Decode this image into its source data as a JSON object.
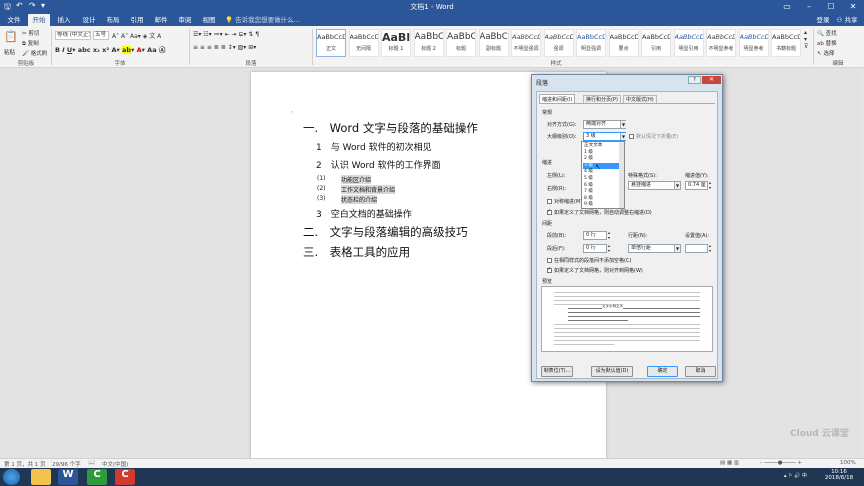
{
  "window": {
    "title": "文档1 - Word"
  },
  "tabs": [
    "文件",
    "开始",
    "插入",
    "设计",
    "布局",
    "引用",
    "邮件",
    "审阅",
    "视图"
  ],
  "search": {
    "placeholder": "告诉我您想要做什么..."
  },
  "account": {
    "login": "登录",
    "share": "共享"
  },
  "ribbon": {
    "clipboard": {
      "paste": "粘贴",
      "cut": "剪切",
      "copy": "复制",
      "format_painter": "格式刷",
      "group": "剪贴板"
    },
    "font": {
      "name": "等线 (中文正文)",
      "size": "五号",
      "group": "字体"
    },
    "paragraph": {
      "group": "段落"
    },
    "styles": {
      "group": "样式",
      "items": [
        {
          "preview": "AaBbCcDı",
          "name": "正文"
        },
        {
          "preview": "AaBbCcDı",
          "name": "无间隔"
        },
        {
          "preview": "AaBl",
          "name": "标题 1"
        },
        {
          "preview": "AaBbC",
          "name": "标题 2"
        },
        {
          "preview": "AaBbC",
          "name": "标题"
        },
        {
          "preview": "AaBbC",
          "name": "副标题"
        },
        {
          "preview": "AaBbCcDı",
          "name": "不明显强调"
        },
        {
          "preview": "AaBbCcDı",
          "name": "强调"
        },
        {
          "preview": "AaBbCcDı",
          "name": "明显强调"
        },
        {
          "preview": "AaBbCcDı",
          "name": "要点"
        },
        {
          "preview": "AaBbCcDı",
          "name": "引用"
        },
        {
          "preview": "AaBbCcDı",
          "name": "明显引用"
        },
        {
          "preview": "AaBbCcDı",
          "name": "不明显参考"
        },
        {
          "preview": "AaBbCcDı",
          "name": "明显参考"
        },
        {
          "preview": "AaBbCcD",
          "name": "书籍标题"
        }
      ]
    },
    "editing": {
      "find": "查找",
      "replace": "替换",
      "select": "选择",
      "group": "编辑"
    }
  },
  "document": {
    "lines": [
      "一.　Word 文字与段落的基础操作",
      "1　与 Word 软件的初次相见",
      "2　认识 Word 软件的工作界面",
      "(1)",
      "功能区介绍",
      "(2)",
      "工作文档和背景介绍",
      "(3)",
      "状态栏的介绍",
      "3　空白文档的基础操作",
      "二.　文字与段落编辑的高级技巧",
      "三.　表格工具的应用"
    ]
  },
  "dialog": {
    "title": "段落",
    "tabs": [
      "缩进和间距(I)",
      "换行和分页(P)",
      "中文版式(H)"
    ],
    "general": "常规",
    "alignment_label": "对齐方式(G):",
    "alignment_value": "两端对齐",
    "outline_label": "大纲级别(O):",
    "outline_value": "3 级",
    "collapse_label": "默认情况下折叠(E)",
    "outline_options": [
      "正文文本",
      "1 级",
      "2 级",
      "3 级",
      "4 级",
      "5 级",
      "6 级",
      "7 级",
      "8 级",
      "9 级"
    ],
    "outline_selected_index": 3,
    "indent_section": "缩进",
    "left_label": "左侧(L):",
    "right_label": "右侧(R):",
    "special_label": "特殊格式(S):",
    "special_value": "悬挂缩进",
    "indent_by_label": "缩进值(Y):",
    "indent_by_value": "0.74 厘",
    "mirror_label": "对称缩进(M)",
    "auto_indent_label": "如果定义了文档网格，则自动调整右缩进(D)",
    "spacing_section": "间距",
    "before_label": "段前(B):",
    "before_value": "0 行",
    "after_label": "段后(F):",
    "after_value": "0 行",
    "line_spacing_label": "行距(N):",
    "line_spacing_value": "单倍行距",
    "at_label": "设置值(A):",
    "no_space_label": "在相同样式的段落间不添加空格(C)",
    "snap_grid_label": "如果定义了文档网格，则对齐到网格(W)",
    "preview_section": "预览",
    "preview_text": "文字示例文字",
    "tabs_button": "制表位(T)...",
    "default_button": "设为默认值(D)",
    "ok_button": "确定",
    "cancel_button": "取消"
  },
  "statusbar": {
    "page": "第 1 页，共 1 页",
    "words": "29/96 个字",
    "lang": "中文(中国)",
    "zoom": "100%"
  },
  "taskbar": {
    "time": "10:16",
    "date": "2018/6/18"
  },
  "watermark": "Cloud 云课堂",
  "colors": {
    "word_blue": "#2b579a",
    "selection_blue": "#3399ff",
    "taskbar": "#1f3752"
  }
}
